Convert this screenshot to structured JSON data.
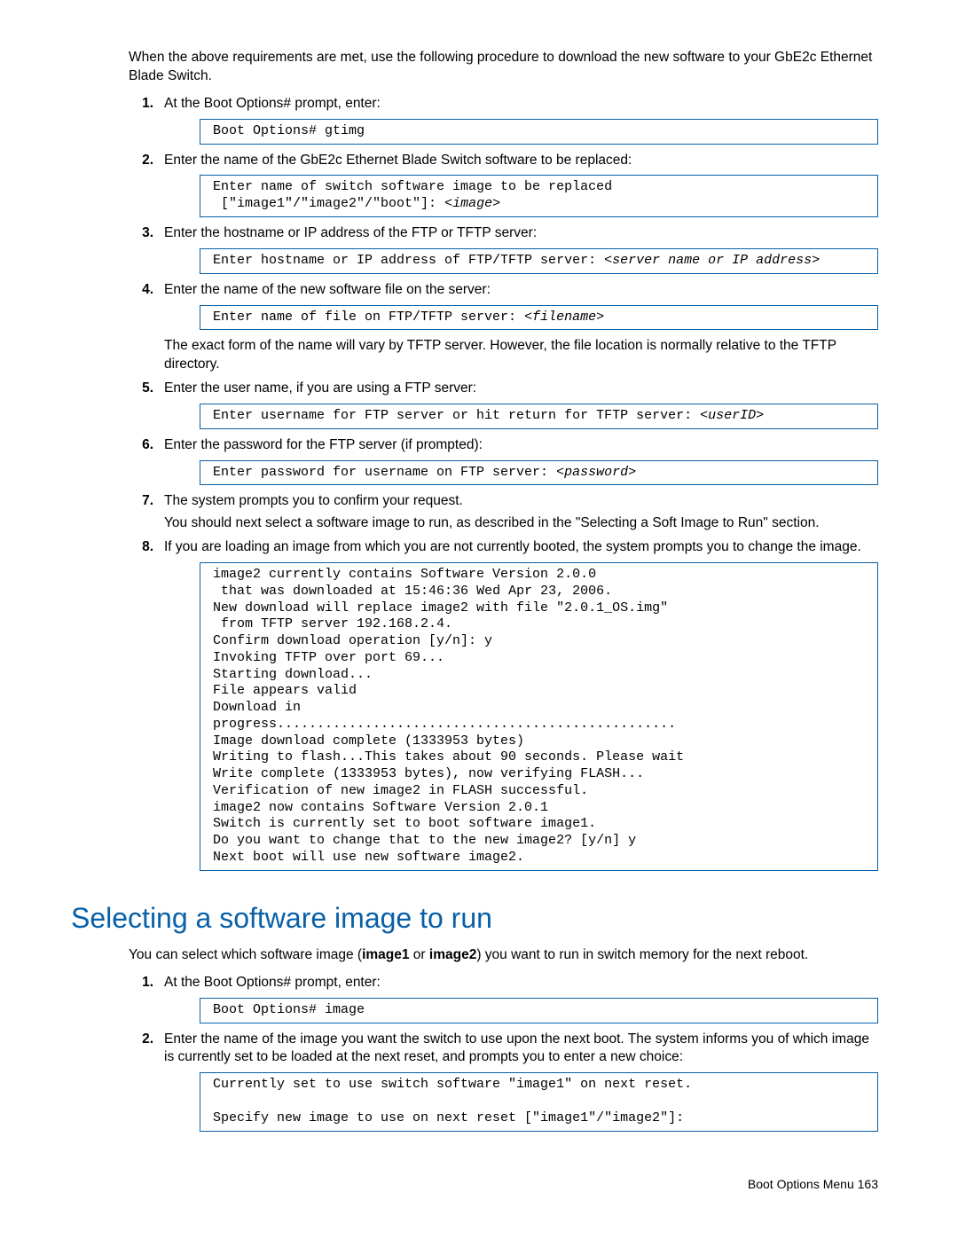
{
  "intro1": "When the above requirements are met, use the following procedure to download the new software to your GbE2c Ethernet Blade Switch.",
  "s1": {
    "t": "At the Boot Options# prompt, enter:",
    "c": "Boot Options# gtimg"
  },
  "s2": {
    "t": "Enter the name of the GbE2c Ethernet Blade Switch software to be replaced:",
    "c1": "Enter name of switch software image to be replaced\n [\"image1\"/\"image2\"/\"boot\"]: ",
    "c2": "<image>"
  },
  "s3": {
    "t": "Enter the hostname or IP address of the FTP or TFTP server:",
    "c1": "Enter hostname or IP address of FTP/TFTP server: ",
    "c2": "<server name or IP address>"
  },
  "s4": {
    "t": "Enter the name of the new software file on the server:",
    "c1": "Enter name of file on FTP/TFTP server: ",
    "c2": "<filename>",
    "note": "The exact form of the name will vary by TFTP server. However, the file location is normally relative to the TFTP directory."
  },
  "s5": {
    "t": "Enter the user name, if you are using a FTP server:",
    "c1": "Enter username for FTP server or hit return for TFTP server: ",
    "c2": "<userID>"
  },
  "s6": {
    "t": "Enter the password for the FTP server (if prompted):",
    "c1": "Enter password for username on FTP server: ",
    "c2": "<password>"
  },
  "s7": {
    "t1": "The system prompts you to confirm your request.",
    "t2": "You should next select a software image to run, as described in the \"Selecting a Soft Image to Run\" section."
  },
  "s8": {
    "t": "If you are loading an image from which you are not currently booted, the system prompts you to change the image.",
    "c": "image2 currently contains Software Version 2.0.0\n that was downloaded at 15:46:36 Wed Apr 23, 2006.\nNew download will replace image2 with file \"2.0.1_OS.img\"\n from TFTP server 192.168.2.4.\nConfirm download operation [y/n]: y\nInvoking TFTP over port 69...\nStarting download...\nFile appears valid\nDownload in\nprogress..................................................\nImage download complete (1333953 bytes)\nWriting to flash...This takes about 90 seconds. Please wait\nWrite complete (1333953 bytes), now verifying FLASH...\nVerification of new image2 in FLASH successful.\nimage2 now contains Software Version 2.0.1\nSwitch is currently set to boot software image1.\nDo you want to change that to the new image2? [y/n] y\nNext boot will use new software image2."
  },
  "h2": "Selecting a software image to run",
  "intro2a": "You can select which software image (",
  "intro2b": "image1",
  "intro2c": " or ",
  "intro2d": "image2",
  "intro2e": ") you want to run in switch memory for the next reboot.",
  "b1": {
    "t": "At the Boot Options# prompt, enter:",
    "c": "Boot Options# image"
  },
  "b2": {
    "t": "Enter the name of the image you want the switch to use upon the next boot. The system informs you of which image is currently set to be loaded at the next reset, and prompts you to enter a new choice:",
    "c": "Currently set to use switch software \"image1\" on next reset.\n\nSpecify new image to use on next reset [\"image1\"/\"image2\"]:"
  },
  "footer": "Boot Options Menu   163"
}
